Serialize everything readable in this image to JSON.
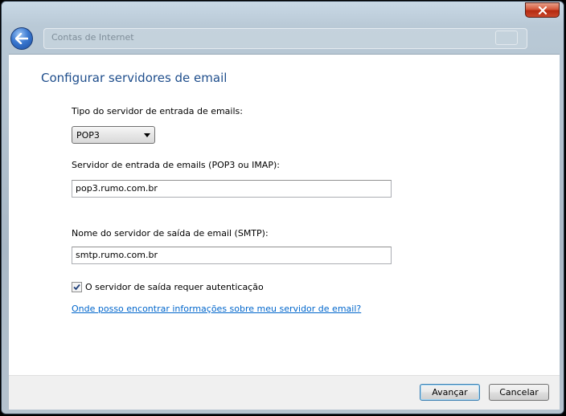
{
  "window": {
    "title_bar_text": "Contas de Internet"
  },
  "page": {
    "heading": "Configurar servidores de email",
    "incoming_type_label": "Tipo do servidor de entrada de emails:",
    "incoming_type_value": "POP3",
    "incoming_server_label": "Servidor de entrada de emails (POP3 ou IMAP):",
    "incoming_server_value": "pop3.rumo.com.br",
    "outgoing_server_label": "Nome do servidor de saída de email (SMTP):",
    "outgoing_server_value": "smtp.rumo.com.br",
    "auth_checkbox_label": "O servidor de saída requer autenticação",
    "auth_checked": true,
    "help_link": "Onde posso encontrar informações sobre meu servidor de email?"
  },
  "footer": {
    "next_label": "Avançar",
    "cancel_label": "Cancelar"
  },
  "colors": {
    "heading": "#1f4e8c",
    "link": "#0066cc",
    "close_button": "#c9472c"
  }
}
